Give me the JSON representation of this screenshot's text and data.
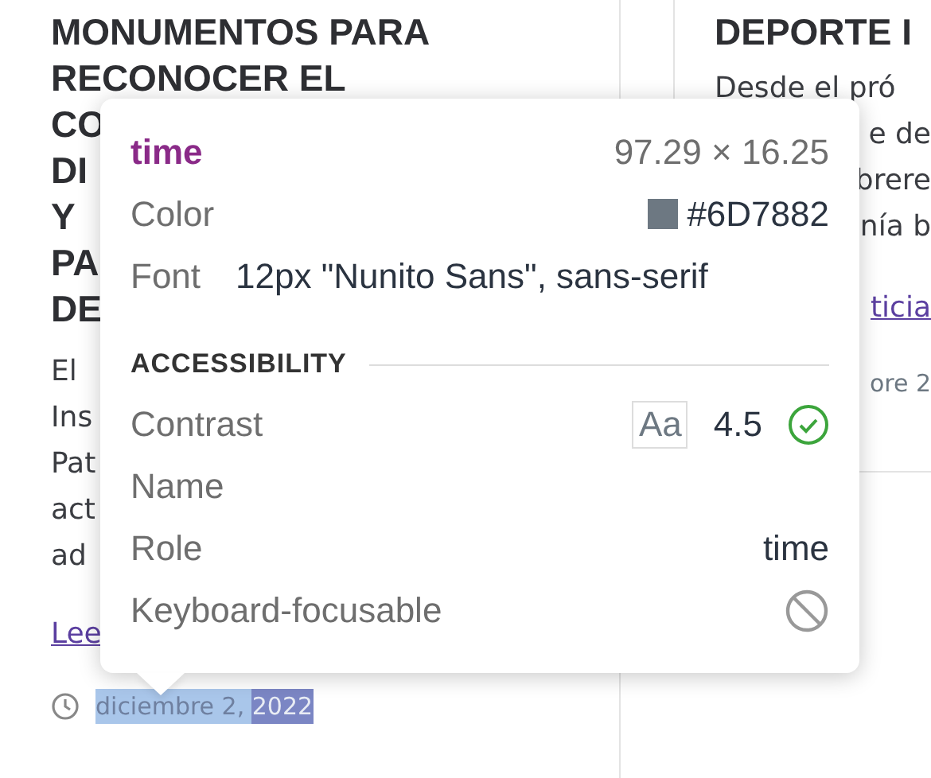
{
  "left_article": {
    "title_lines": [
      "MONUMENTOS PARA",
      "RECONOCER EL",
      "CO",
      "DI",
      "Y",
      "PA",
      "DE"
    ],
    "body_lines": [
      "El",
      "Ins",
      "Pat",
      "act",
      "ad"
    ],
    "link": "Lee",
    "date_parts": [
      {
        "text": "diciembre 2, ",
        "inspected": false
      },
      {
        "text": "2022",
        "inspected": true
      }
    ]
  },
  "right_article": {
    "title": "DEPORTE I",
    "body_lines": [
      "Desde el pró",
      "e de",
      "brere",
      "nía b"
    ],
    "link": "ticia",
    "date": "ore 2"
  },
  "inspector": {
    "tag": "time",
    "size": "97.29 × 16.25",
    "rows": [
      {
        "kind": "color",
        "label": "Color",
        "value": "#6D7882"
      },
      {
        "kind": "text",
        "label": "Font",
        "value": "12px \"Nunito Sans\", sans-serif"
      }
    ],
    "section": "ACCESSIBILITY",
    "a11y": [
      {
        "kind": "contrast",
        "label": "Contrast",
        "sample": "Aa",
        "value": "4.5",
        "passes": true
      },
      {
        "kind": "text",
        "label": "Name"
      },
      {
        "kind": "text",
        "label": "Role",
        "value": "time"
      },
      {
        "kind": "focusable",
        "label": "Keyboard-focusable",
        "focusable": false
      }
    ]
  }
}
